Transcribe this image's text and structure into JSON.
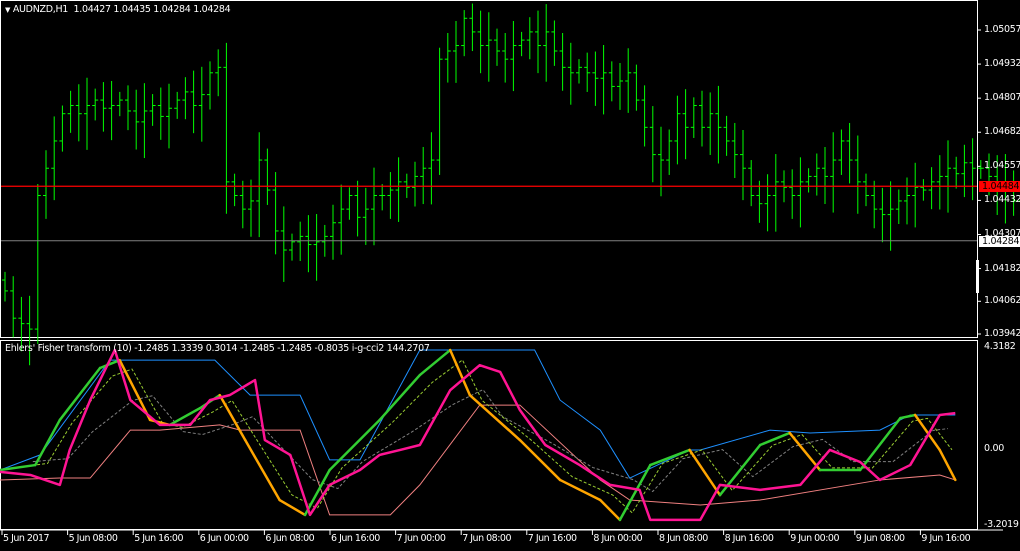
{
  "header": {
    "symbol": "AUDNZD,H1",
    "ohlc": "1.04427 1.04435 1.04284 1.04284",
    "menu_icon": "triangle-down-icon"
  },
  "indicator_header": {
    "text": "Ehlers' Fisher transform (10) -1.2485 1.3339 0.3014 -1.2485 -1.2485 -0.8035  i-g-cci2 144.2707"
  },
  "price_axis": {
    "labels": [
      "1.05057",
      "1.04932",
      "1.04807",
      "1.04682",
      "1.04557",
      "1.04432",
      "1.04307",
      "1.04182",
      "1.04062",
      "1.03942"
    ],
    "levels": [
      1.05057,
      1.04932,
      1.04807,
      1.04682,
      1.04557,
      1.04432,
      1.04307,
      1.04182,
      1.04062,
      1.03942
    ],
    "red_line": {
      "label": "1.04484",
      "value": 1.04484,
      "color": "#ff0000"
    },
    "bid_line": {
      "label": "1.04284",
      "value": 1.04284,
      "color": "#808080"
    }
  },
  "indicator_axis": {
    "labels": [
      "4.3182",
      "0.00",
      "-3.2019"
    ],
    "levels": [
      4.3182,
      0,
      -3.2019
    ]
  },
  "time_axis": {
    "labels": [
      "5 Jun 2017",
      "5 Jun 08:00",
      "5 Jun 16:00",
      "6 Jun 00:00",
      "6 Jun 08:00",
      "6 Jun 16:00",
      "7 Jun 00:00",
      "7 Jun 08:00",
      "7 Jun 16:00",
      "8 Jun 00:00",
      "8 Jun 08:00",
      "8 Jun 16:00",
      "9 Jun 00:00",
      "9 Jun 08:00",
      "9 Jun 16:00"
    ],
    "bars_per_label": 8
  },
  "colors": {
    "bars": "#00ff00",
    "fisher_up": "#32cd32",
    "fisher_down": "#ffa500",
    "cci": "#ff1493",
    "upper": "#1e90ff",
    "lower": "#f08080",
    "signal": "#9acd32",
    "slow": "#808080"
  },
  "chart_data": {
    "type": "line",
    "symbol": "AUDNZD",
    "timeframe": "H1",
    "price": {
      "ylim": [
        1.03942,
        1.05057
      ],
      "close": [
        1.041,
        1.04,
        1.0398,
        1.0396,
        1.0445,
        1.0455,
        1.0465,
        1.0475,
        1.0478,
        1.0475,
        1.0478,
        1.048,
        1.0477,
        1.0478,
        1.048,
        1.0476,
        1.0472,
        1.0476,
        1.0478,
        1.0474,
        1.0477,
        1.048,
        1.0483,
        1.0478,
        1.0482,
        1.049,
        1.0492,
        1.045,
        1.0445,
        1.044,
        1.0443,
        1.0458,
        1.0447,
        1.0432,
        1.0425,
        1.0428,
        1.043,
        1.0427,
        1.0428,
        1.043,
        1.0435,
        1.044,
        1.0445,
        1.0437,
        1.044,
        1.0445,
        1.0445,
        1.0447,
        1.045,
        1.0448,
        1.0452,
        1.0455,
        1.0458,
        1.0495,
        1.0498,
        1.05,
        1.051,
        1.0505,
        1.05,
        1.0502,
        1.0498,
        1.0495,
        1.05,
        1.0502,
        1.0505,
        1.05,
        1.0505,
        1.0498,
        1.0492,
        1.049,
        1.0492,
        1.049,
        1.0488,
        1.049,
        1.0485,
        1.0487,
        1.049,
        1.048,
        1.047,
        1.046,
        1.0458,
        1.0465,
        1.0475,
        1.047,
        1.0478,
        1.047,
        1.0475,
        1.047,
        1.0465,
        1.046,
        1.0455,
        1.0445,
        1.0442,
        1.0445,
        1.045,
        1.0448,
        1.0445,
        1.045,
        1.0452,
        1.0455,
        1.0452,
        1.0458,
        1.0465,
        1.0458,
        1.045,
        1.0445,
        1.044,
        1.0438,
        1.044,
        1.0443,
        1.0445,
        1.0448,
        1.0447,
        1.045,
        1.0452,
        1.0455,
        1.0453,
        1.0457,
        1.0455,
        1.0455,
        1.0452,
        1.0448,
        1.045,
        1.0443,
        1.044,
        1.0438,
        1.0428
      ]
    },
    "indicator": {
      "ylim": [
        -3.2019,
        4.3182
      ],
      "fisher": [
        [
          0,
          -0.89
        ],
        [
          4.3,
          -0.68
        ],
        [
          7.3,
          1.23
        ],
        [
          12.2,
          3.43
        ],
        [
          14.6,
          3.76
        ],
        [
          18.3,
          1.23
        ],
        [
          20.7,
          1.02
        ],
        [
          24.4,
          1.73
        ],
        [
          26.8,
          2.28
        ],
        [
          29.9,
          0.38
        ],
        [
          34.1,
          -2.16
        ],
        [
          37.2,
          -2.79
        ],
        [
          40.2,
          -0.89
        ],
        [
          46.3,
          1.23
        ],
        [
          51.2,
          3.13
        ],
        [
          54.9,
          4.19
        ],
        [
          57.3,
          2.28
        ],
        [
          63.4,
          0.38
        ],
        [
          68.3,
          -1.31
        ],
        [
          73.2,
          -2.16
        ],
        [
          75.6,
          -3.0
        ],
        [
          79.3,
          -0.68
        ],
        [
          84.1,
          -0.04
        ],
        [
          87.8,
          -1.95
        ],
        [
          92.7,
          0.17
        ],
        [
          96.3,
          0.68
        ],
        [
          100,
          -0.89
        ],
        [
          104.9,
          -0.89
        ],
        [
          109.8,
          1.31
        ],
        [
          111.6,
          1.44
        ],
        [
          114.6,
          -0.04
        ],
        [
          116.5,
          -1.31
        ]
      ],
      "cci": [
        [
          0,
          -0.97
        ],
        [
          3.7,
          -1.1
        ],
        [
          7.3,
          -1.52
        ],
        [
          8.5,
          -0.04
        ],
        [
          11,
          2.07
        ],
        [
          14,
          4.19
        ],
        [
          15.9,
          2.07
        ],
        [
          19.5,
          1.02
        ],
        [
          23.2,
          1.02
        ],
        [
          25.6,
          2.07
        ],
        [
          28,
          2.28
        ],
        [
          31.1,
          2.92
        ],
        [
          32.3,
          0.38
        ],
        [
          35.4,
          -0.25
        ],
        [
          37.8,
          -2.79
        ],
        [
          40.2,
          -1.52
        ],
        [
          43.9,
          -0.89
        ],
        [
          46.3,
          -0.25
        ],
        [
          48.8,
          -0.04
        ],
        [
          51.2,
          0.17
        ],
        [
          54.9,
          2.49
        ],
        [
          58.5,
          3.55
        ],
        [
          61,
          3.26
        ],
        [
          63.4,
          1.65
        ],
        [
          66.5,
          0.17
        ],
        [
          70.7,
          -0.68
        ],
        [
          74.4,
          -1.52
        ],
        [
          78,
          -1.73
        ],
        [
          79.3,
          -3.0
        ],
        [
          85.4,
          -3.0
        ],
        [
          87.8,
          -1.52
        ],
        [
          92.7,
          -1.73
        ],
        [
          97.6,
          -1.52
        ],
        [
          101.2,
          -0.04
        ],
        [
          104.9,
          -0.55
        ],
        [
          107.3,
          -1.31
        ],
        [
          111,
          -0.68
        ],
        [
          114.6,
          1.44
        ],
        [
          116.5,
          1.52
        ]
      ],
      "upper": [
        [
          0,
          -0.89
        ],
        [
          4.9,
          -0.25
        ],
        [
          13.4,
          3.76
        ],
        [
          26.2,
          3.76
        ],
        [
          30.5,
          2.28
        ],
        [
          36.6,
          2.28
        ],
        [
          40.2,
          -0.46
        ],
        [
          43.9,
          -0.46
        ],
        [
          51.2,
          4.19
        ],
        [
          65.2,
          4.19
        ],
        [
          68.3,
          2.07
        ],
        [
          73.2,
          0.8
        ],
        [
          76.8,
          -1.23
        ],
        [
          84.1,
          -0.04
        ],
        [
          85.4,
          -0.04
        ],
        [
          93.9,
          0.8
        ],
        [
          98.8,
          0.68
        ],
        [
          107.3,
          0.8
        ],
        [
          111,
          1.44
        ],
        [
          116.5,
          1.44
        ]
      ],
      "lower": [
        [
          0,
          -1.31
        ],
        [
          7.3,
          -1.23
        ],
        [
          11,
          -1.23
        ],
        [
          15.9,
          0.8
        ],
        [
          19.5,
          0.8
        ],
        [
          26.8,
          1.02
        ],
        [
          29.3,
          0.8
        ],
        [
          36.6,
          0.8
        ],
        [
          40.2,
          -2.79
        ],
        [
          47.6,
          -2.79
        ],
        [
          51.2,
          -1.52
        ],
        [
          58.5,
          1.86
        ],
        [
          63.4,
          1.86
        ],
        [
          73.2,
          -1.31
        ],
        [
          76.8,
          -2.16
        ],
        [
          85.4,
          -2.37
        ],
        [
          92.7,
          -2.16
        ],
        [
          107.3,
          -1.31
        ],
        [
          114.6,
          -1.1
        ],
        [
          116.5,
          -1.31
        ]
      ]
    }
  }
}
